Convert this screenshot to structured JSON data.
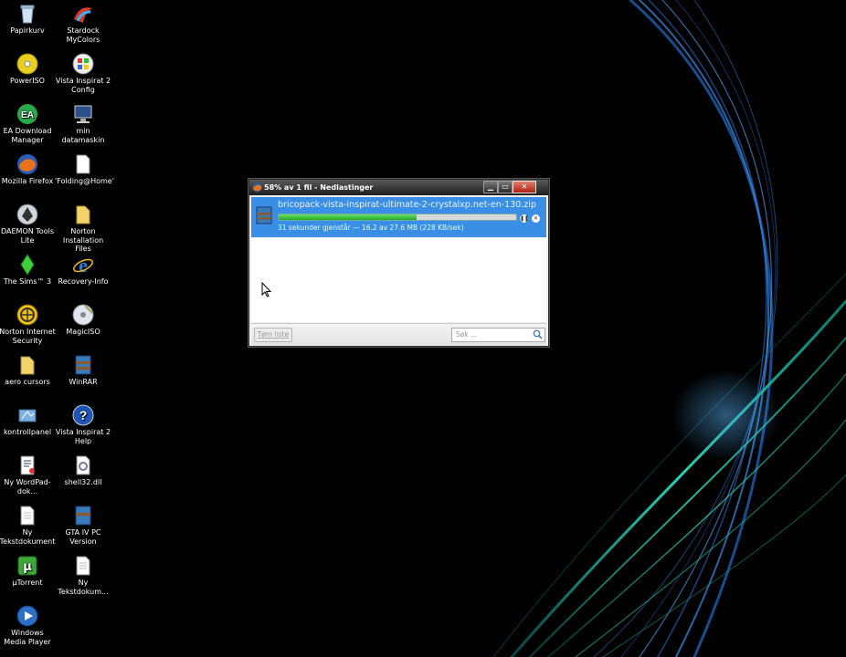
{
  "desktop": {
    "icons": [
      {
        "label": "Papirkurv",
        "icon": "recycle-bin-icon"
      },
      {
        "label": "Stardock MyColors",
        "icon": "stardock-icon"
      },
      {
        "label": "PowerISO",
        "icon": "disc-icon"
      },
      {
        "label": "Vista Inspirat 2 Config",
        "icon": "vista-config-icon"
      },
      {
        "label": "EA Download Manager",
        "icon": "ea-icon"
      },
      {
        "label": "min datamaskin",
        "icon": "computer-icon"
      },
      {
        "label": "Mozilla Firefox",
        "icon": "firefox-icon"
      },
      {
        "label": "'Folding@Home'",
        "icon": "document-icon"
      },
      {
        "label": "DAEMON Tools Lite",
        "icon": "daemon-tools-icon"
      },
      {
        "label": "Norton Installation Files",
        "icon": "folder-icon"
      },
      {
        "label": "The Sims™ 3",
        "icon": "sims-icon"
      },
      {
        "label": "Recovery-Info",
        "icon": "internet-explorer-icon"
      },
      {
        "label": "Norton Internet Security",
        "icon": "norton-icon"
      },
      {
        "label": "MagicISO",
        "icon": "magiciso-icon"
      },
      {
        "label": "aero cursors",
        "icon": "folder-icon"
      },
      {
        "label": "WinRAR",
        "icon": "winrar-icon"
      },
      {
        "label": "kontrollpanel",
        "icon": "control-panel-icon"
      },
      {
        "label": "Vista Inspirat 2 Help",
        "icon": "help-icon"
      },
      {
        "label": "Ny WordPad-dok...",
        "icon": "wordpad-icon"
      },
      {
        "label": "shell32.dll",
        "icon": "dll-icon"
      },
      {
        "label": "Ny Tekstdokument",
        "icon": "text-document-icon"
      },
      {
        "label": "GTA IV PC Version",
        "icon": "archive-icon"
      },
      {
        "label": "µTorrent",
        "icon": "utorrent-icon"
      },
      {
        "label": "Ny Tekstdokum...",
        "icon": "text-document-icon"
      },
      {
        "label": "Windows Media Player",
        "icon": "media-player-icon"
      }
    ]
  },
  "download_window": {
    "title": "58% av 1 fil - Nedlastinger",
    "item": {
      "filename": "bricopack-vista-inspirat-ultimate-2-crystalxp.net-en-130.zip",
      "status": "31 sekunder gjenstår — 16.2 av 27.6 MB (228 KB/sek)",
      "progress_fraction": 0.58
    },
    "clear_button": "Tøm liste",
    "search_placeholder": "Søk ..."
  },
  "colors": {
    "accent": "#3a8ee6",
    "progress": "#23a91f",
    "swirl_blue": "#4aa8ff",
    "swirl_cyan": "#32e6c8"
  }
}
